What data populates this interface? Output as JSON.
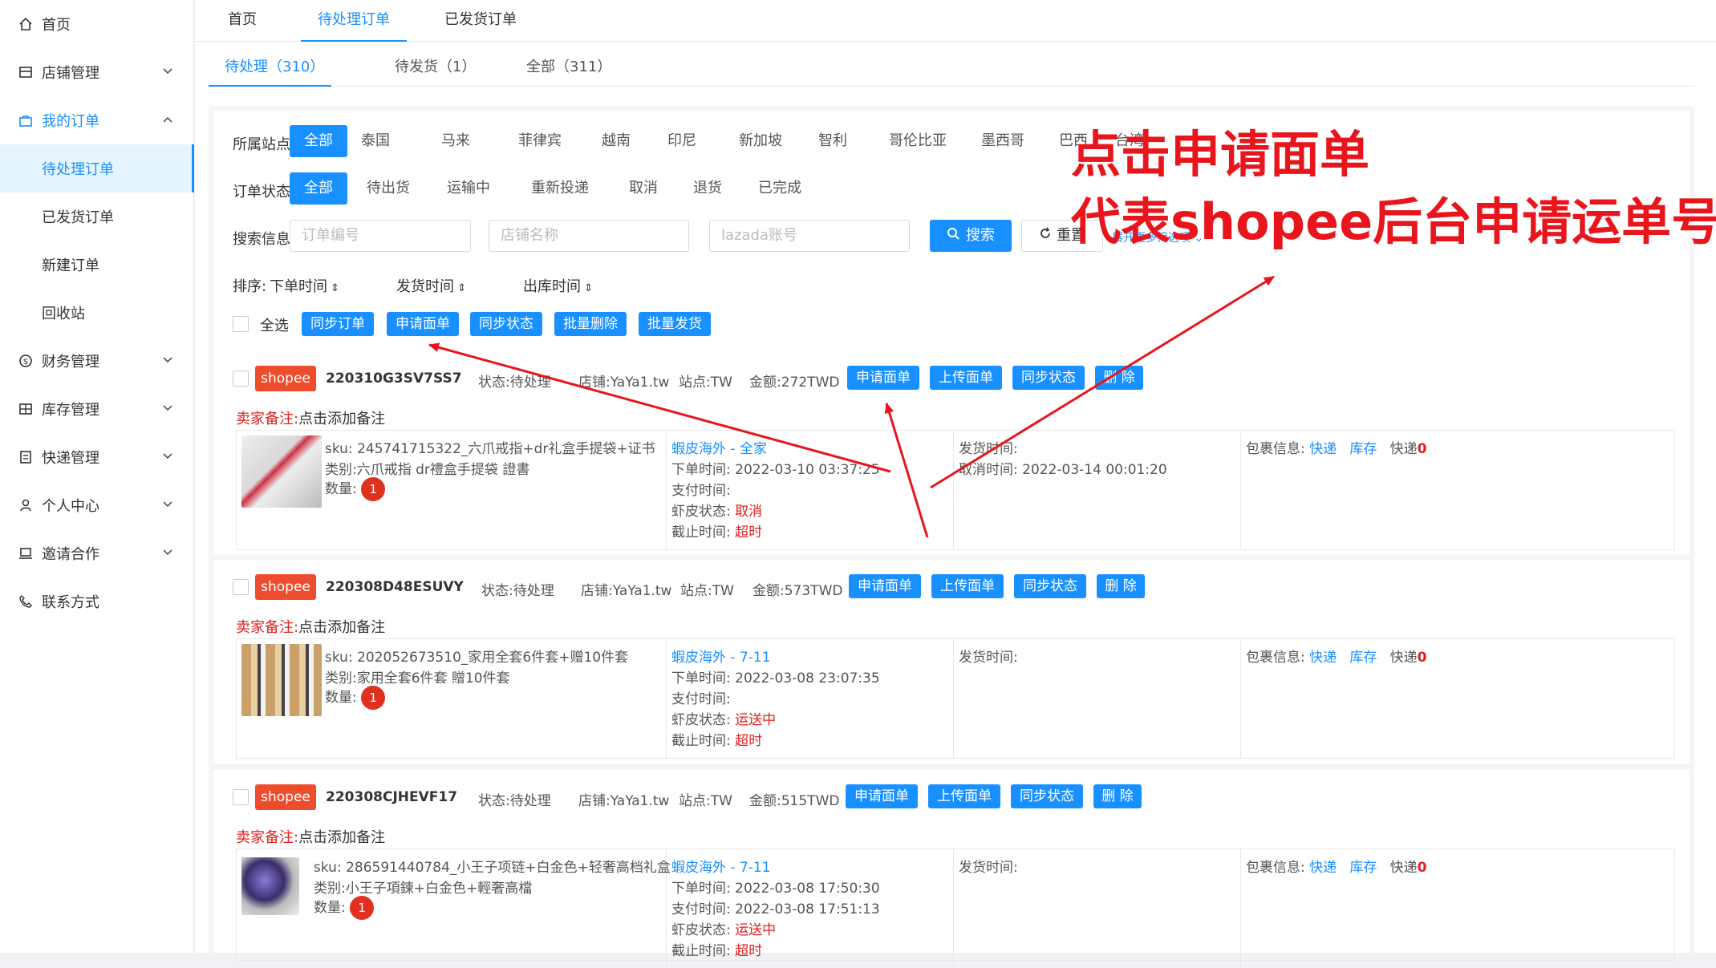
{
  "sidebar": {
    "items": [
      {
        "label": "首页"
      },
      {
        "label": "店铺管理"
      },
      {
        "label": "我的订单"
      },
      {
        "label": "待处理订单"
      },
      {
        "label": "已发货订单"
      },
      {
        "label": "新建订单"
      },
      {
        "label": "回收站"
      },
      {
        "label": "财务管理"
      },
      {
        "label": "库存管理"
      },
      {
        "label": "快递管理"
      },
      {
        "label": "个人中心"
      },
      {
        "label": "邀请合作"
      },
      {
        "label": "联系方式"
      }
    ]
  },
  "top_tabs": [
    "首页",
    "待处理订单",
    "已发货订单"
  ],
  "sub_tabs": [
    "待处理（310）",
    "待发货（1）",
    "全部（311）"
  ],
  "filters": {
    "site_label": "所属站点:",
    "sites": [
      "全部",
      "泰国",
      "马来",
      "菲律宾",
      "越南",
      "印尼",
      "新加坡",
      "智利",
      "哥伦比亚",
      "墨西哥",
      "巴西",
      "台湾"
    ],
    "status_label": "订单状态:",
    "statuses": [
      "全部",
      "待出货",
      "运输中",
      "重新投递",
      "取消",
      "退货",
      "已完成"
    ],
    "search_label": "搜索信息:",
    "placeholders": [
      "订单编号",
      "店铺名称",
      "lazada账号"
    ],
    "search_btn": "搜索",
    "reset_btn": "重置",
    "more_link": "展开更多筛选项",
    "sort_label": "排序:",
    "sorts": [
      "下单时间",
      "发货时间",
      "出库时间"
    ],
    "select_all": "全选",
    "bulk_buttons": [
      "同步订单",
      "申请面单",
      "同步状态",
      "批量删除",
      "批量发货"
    ]
  },
  "order_buttons": [
    "申请面单",
    "上传面单",
    "同步状态",
    "删 除"
  ],
  "labels": {
    "shop": "shopee",
    "status": "状态:",
    "store": "店铺:",
    "site": "站点:",
    "amount": "金额:",
    "seller_note": "卖家备注:",
    "add_note": "点击添加备注",
    "sku": "sku:",
    "category": "类别:",
    "qty": "数量:",
    "order_time": "下单时间:",
    "pay_time": "支付时间:",
    "shopee_status": "虾皮状态:",
    "deadline": "截止时间:",
    "ship_time": "发货时间:",
    "cancel_time": "取消时间:",
    "package": "包裹信息:",
    "express": "快递",
    "stock": "库存",
    "express_count": "快递"
  },
  "orders": [
    {
      "id": "220310G3SV7SS7",
      "status": "待处理",
      "store": "YaYa1.tw",
      "site": "TW",
      "amount": "272TWD",
      "sku": "245741715322_六爪戒指+dr礼盒手提袋+证书",
      "category": "六爪戒指 dr禮盒手提袋 證書",
      "qty": "1",
      "channel": "蝦皮海外 - 全家",
      "order_time": "2022-03-10 03:37:25",
      "pay_time": "",
      "shopee_status": "取消",
      "deadline": "超时",
      "ship_time": "",
      "cancel_time": "2022-03-14 00:01:20",
      "express_num": "0"
    },
    {
      "id": "220308D48ESUVY",
      "status": "待处理",
      "store": "YaYa1.tw",
      "site": "TW",
      "amount": "573TWD",
      "sku": "202052673510_家用全套6件套+赠10件套",
      "category": "家用全套6件套 贈10件套",
      "qty": "1",
      "channel": "蝦皮海外 - 7-11",
      "order_time": "2022-03-08 23:07:35",
      "pay_time": "",
      "shopee_status": "运送中",
      "deadline": "超时",
      "ship_time": "",
      "express_num": "0"
    },
    {
      "id": "220308CJHEVF17",
      "status": "待处理",
      "store": "YaYa1.tw",
      "site": "TW",
      "amount": "515TWD",
      "sku": "286591440784_小王子项链+白金色+轻奢高档礼盒",
      "category": "小王子項鍊+白金色+輕奢高檔",
      "qty": "1",
      "channel": "蝦皮海外 - 7-11",
      "order_time": "2022-03-08 17:50:30",
      "pay_time": "2022-03-08 17:51:13",
      "shopee_status": "运送中",
      "deadline": "超时",
      "ship_time": "",
      "express_num": "0"
    }
  ],
  "annotation": {
    "line1": "点击申请面单",
    "line2": "代表shopee后台申请运单号"
  },
  "colors": {
    "accent": "#1890ff",
    "shopee": "#ee4d2d",
    "annotation": "#e8161c"
  }
}
